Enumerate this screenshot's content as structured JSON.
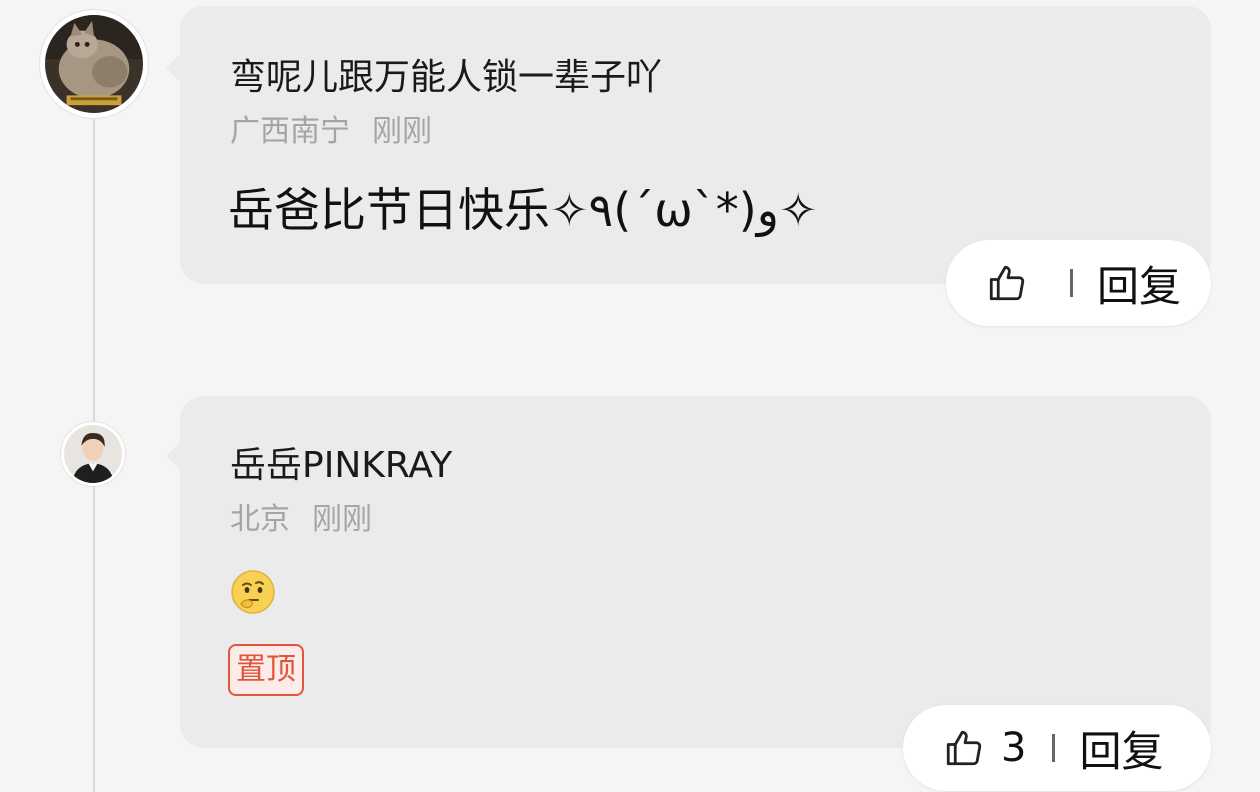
{
  "comments": [
    {
      "username": "弯呢儿跟万能人锁一辈子吖",
      "location": "广西南宁",
      "time": "刚刚",
      "text": "岳爸比节日快乐✧٩(ˊωˋ*)و✧",
      "like_count": "",
      "reply_label": "回复",
      "avatar_icon": "cat-photo-avatar"
    },
    {
      "username": "岳岳PINKRAY",
      "location": "北京",
      "time": "刚刚",
      "emoji_icon": "thinking-face-emoji",
      "pinned_label": "置顶",
      "like_count": "3",
      "reply_label": "回复",
      "avatar_icon": "person-photo-avatar"
    }
  ],
  "colors": {
    "background": "#f5f5f5",
    "bubble": "#ebebeb",
    "pinned": "#e0553b",
    "meta_text": "#a5a5a5"
  }
}
